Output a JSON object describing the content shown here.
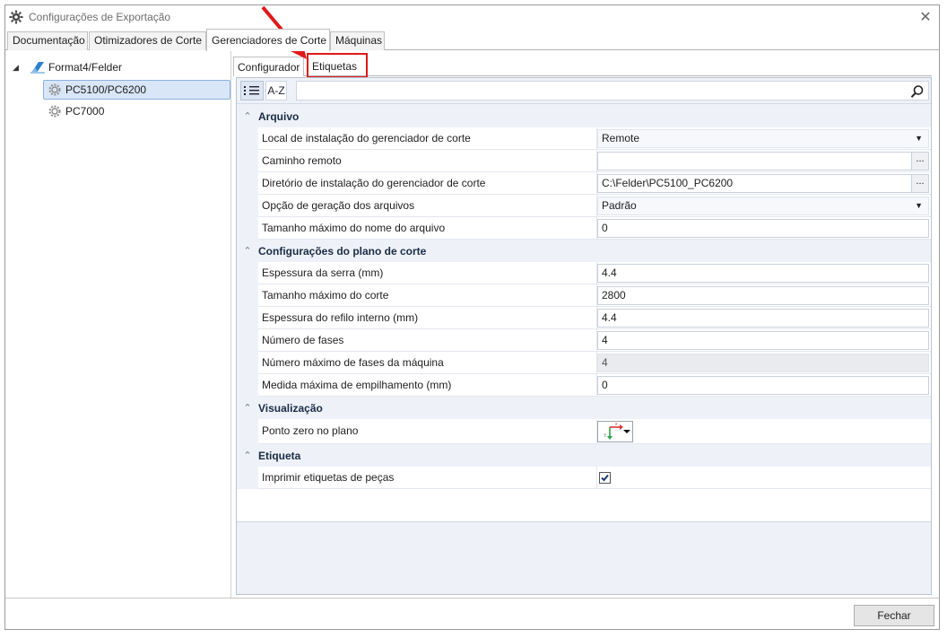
{
  "window": {
    "title": "Configurações de Exportação",
    "close_glyph": "✕"
  },
  "top_tabs": [
    {
      "label": "Documentação"
    },
    {
      "label": "Otimizadores de Corte"
    },
    {
      "label": "Gerenciadores de Corte"
    },
    {
      "label": "Máquinas"
    }
  ],
  "tree": {
    "root": "Format4/Felder",
    "children": [
      "PC5100/PC6200",
      "PC7000"
    ]
  },
  "inner_tabs": [
    {
      "label": "Configurador"
    },
    {
      "label": "Etiquetas"
    }
  ],
  "toolbar": {
    "categorized_icon": "categorized-icon",
    "alphabetical_label": "A-Z",
    "search_placeholder": ""
  },
  "categories": [
    {
      "title": "Arquivo",
      "props": [
        {
          "name": "Local de instalação do gerenciador de corte",
          "value": "Remote",
          "editor": "combo"
        },
        {
          "name": "Caminho remoto",
          "value": "",
          "editor": "browse"
        },
        {
          "name": "Diretório de instalação do gerenciador de corte",
          "value": "C:\\Felder\\PC5100_PC6200",
          "editor": "browse"
        },
        {
          "name": "Opção de geração dos arquivos",
          "value": "Padrão",
          "editor": "combo"
        },
        {
          "name": "Tamanho máximo do nome do arquivo",
          "value": "0",
          "editor": "text"
        }
      ]
    },
    {
      "title": "Configurações do plano de corte",
      "props": [
        {
          "name": "Espessura da serra (mm)",
          "value": "4.4",
          "editor": "text"
        },
        {
          "name": "Tamanho máximo do corte",
          "value": "2800",
          "editor": "text"
        },
        {
          "name": "Espessura do refilo interno (mm)",
          "value": "4.4",
          "editor": "text"
        },
        {
          "name": "Número de fases",
          "value": "4",
          "editor": "text"
        },
        {
          "name": "Número máximo de fases da máquina",
          "value": "4",
          "editor": "disabled"
        },
        {
          "name": "Medida máxima de empilhamento (mm)",
          "value": "0",
          "editor": "text"
        }
      ]
    },
    {
      "title": "Visualização",
      "props": [
        {
          "name": "Ponto zero no plano",
          "value": "",
          "editor": "origin"
        }
      ]
    },
    {
      "title": "Etiqueta",
      "props": [
        {
          "name": "Imprimir etiquetas de peças",
          "value": "",
          "editor": "checkbox",
          "checked": true
        }
      ]
    }
  ],
  "footer": {
    "close_label": "Fechar"
  },
  "colors": {
    "highlight": "#e01818",
    "selection": "#d8e6f7"
  }
}
